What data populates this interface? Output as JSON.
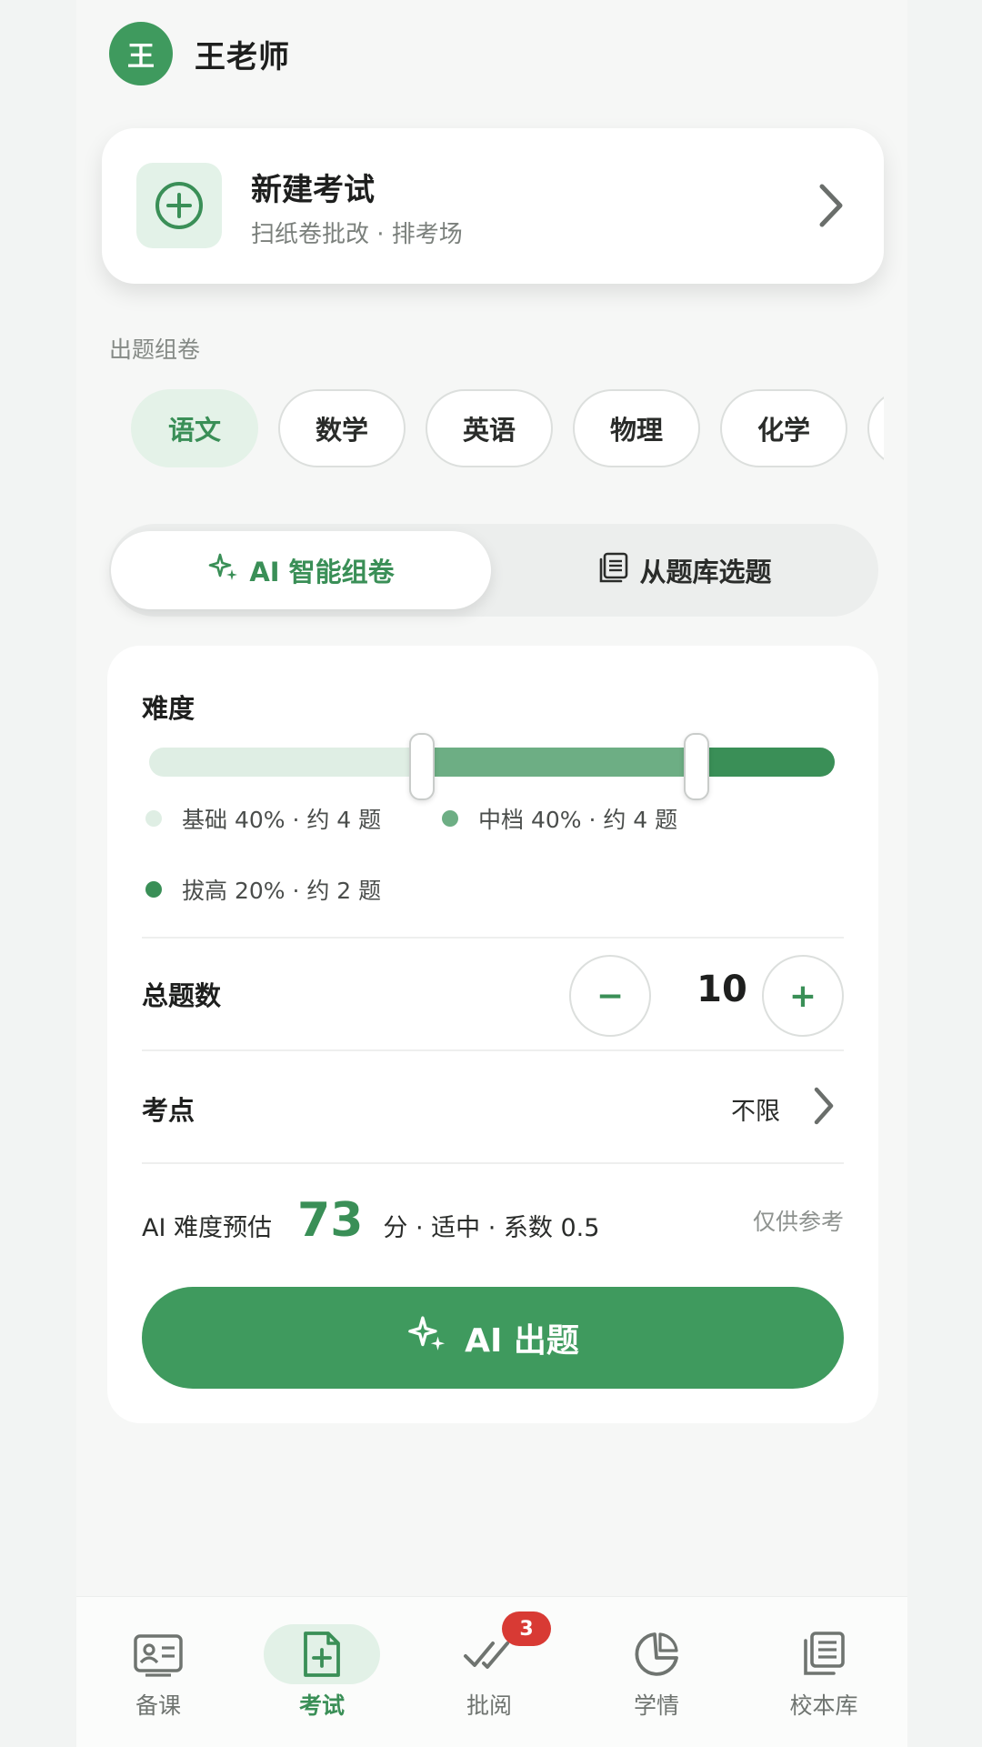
{
  "header": {
    "avatar_text": "王",
    "teacher_name": "王老师"
  },
  "new_exam": {
    "title": "新建考试",
    "subtitle": "扫纸卷批改 · 排考场",
    "icon": "plus-circle-icon"
  },
  "section_label": "出题组卷",
  "subjects": [
    {
      "label": "语文",
      "active": true
    },
    {
      "label": "数学"
    },
    {
      "label": "英语"
    },
    {
      "label": "物理"
    },
    {
      "label": "化学"
    }
  ],
  "modes": {
    "ai_label": "AI 智能组卷",
    "bank_label": "从题库选题",
    "active": "ai"
  },
  "difficulty": {
    "title": "难度",
    "basic": {
      "label": "基础 40% · 约 4 题",
      "fraction": 0.4,
      "color": "#dfeee4"
    },
    "medium": {
      "label": "中档 40% · 约 4 题",
      "fraction": 0.4,
      "color": "#6dae84"
    },
    "advanced": {
      "label": "拔高 20% · 约 2 题",
      "fraction": 0.2,
      "color": "#3a8f57"
    }
  },
  "total": {
    "label": "总题数",
    "value": "10",
    "minus": "−",
    "plus": "+"
  },
  "knowledge_points": {
    "label": "考点",
    "value": "不限"
  },
  "estimate": {
    "prefix": "AI 难度预估",
    "score": "73",
    "suffix": "分 · 适中 · 系数 0.5",
    "note": "仅供参考"
  },
  "ai_button": {
    "label": "AI 出题"
  },
  "nav": {
    "items": [
      {
        "label": "备课",
        "icon": "id-card-icon"
      },
      {
        "label": "考试",
        "icon": "file-plus-icon",
        "active": true
      },
      {
        "label": "批阅",
        "icon": "double-check-icon",
        "badge": "3"
      },
      {
        "label": "学情",
        "icon": "moon-chart-icon"
      },
      {
        "label": "校本库",
        "icon": "library-icon"
      }
    ]
  },
  "colors": {
    "accent": "#3f9a5e",
    "accent_light": "#e4f2e8",
    "badge": "#d83a34"
  }
}
